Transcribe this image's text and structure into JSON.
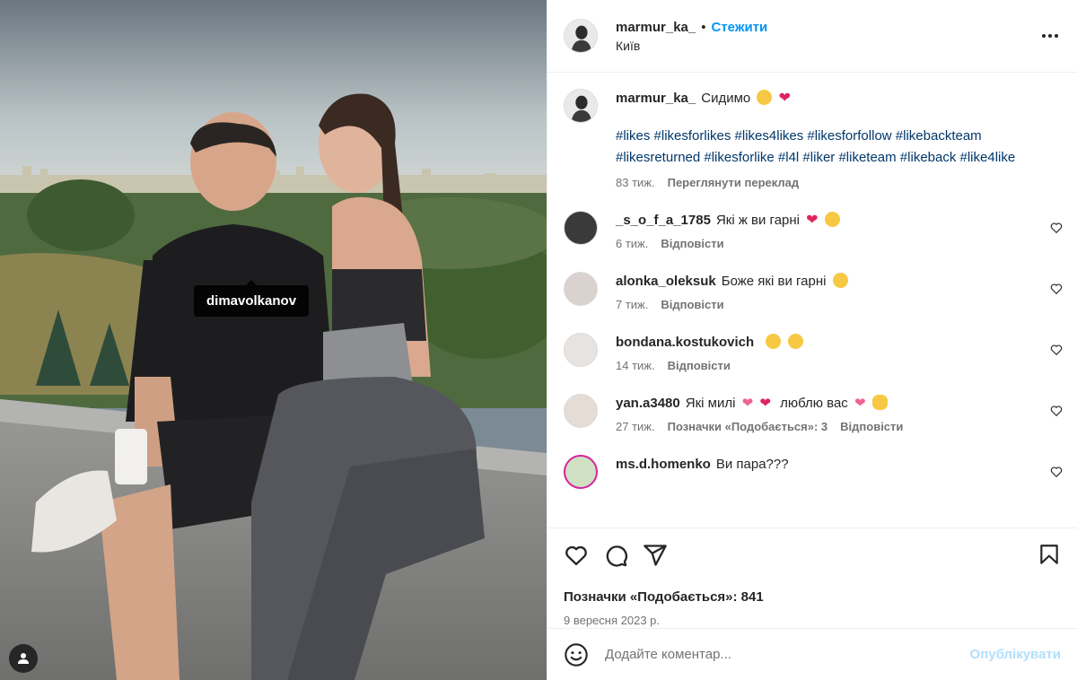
{
  "photo": {
    "tag_username": "dimavolkanov",
    "tags_icon": "person-icon"
  },
  "header": {
    "username": "marmur_ka_",
    "separator": "•",
    "follow_label": "Стежити",
    "location": "Київ",
    "more_icon": "more-horizontal-icon"
  },
  "caption": {
    "username": "marmur_ka_",
    "text": "Сидимо",
    "hashtags": "#likes #likesforlikes #likes4likes #likesforfollow #likebackteam #likesreturned #likesforlike #l4l #liker #liketeam #likeback #like4like",
    "time": "83 тиж.",
    "translate_label": "Переглянути переклад"
  },
  "comments": [
    {
      "username": "_s_o_f_a_1785",
      "text": "Які ж ви гарні",
      "time": "6 тиж.",
      "likes": "",
      "reply": "Відповісти"
    },
    {
      "username": "alonka_oleksuk",
      "text": "Боже які ви гарні",
      "time": "7 тиж.",
      "likes": "",
      "reply": "Відповісти"
    },
    {
      "username": "bondana.kostukovich",
      "text": "",
      "time": "14 тиж.",
      "likes": "",
      "reply": "Відповісти"
    },
    {
      "username": "yan.a3480",
      "text": "Які милі",
      "text2": "люблю вас",
      "time": "27 тиж.",
      "likes": "Позначки «Подобається»: 3",
      "reply": "Відповісти"
    },
    {
      "username": "ms.d.homenko",
      "text": "Ви пара???",
      "time": "",
      "likes": "",
      "reply": ""
    }
  ],
  "actions": {
    "like_icon": "heart-icon",
    "comment_icon": "comment-icon",
    "share_icon": "send-icon",
    "save_icon": "bookmark-icon",
    "likes_text": "Позначки «Подобається»: 841",
    "date": "9 вересня 2023 р."
  },
  "add_comment": {
    "emoji_icon": "smiley-icon",
    "placeholder": "Додайте коментар...",
    "post_label": "Опублікувати"
  },
  "colors": {
    "accent": "#0095f6",
    "hashtag": "#00376b",
    "muted": "#737373",
    "post_disabled": "#b2dffc"
  }
}
